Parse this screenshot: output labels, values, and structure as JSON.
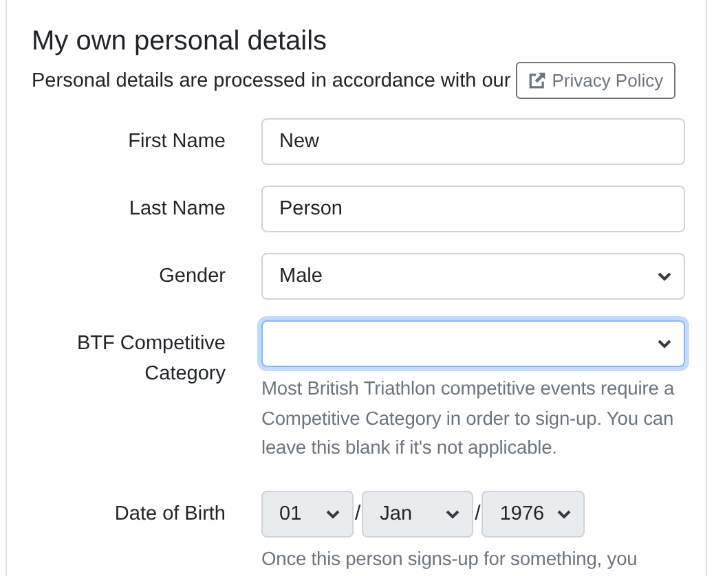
{
  "heading": "My own personal details",
  "notice": {
    "text": "Personal details are processed in accordance with our",
    "link": "Privacy Policy"
  },
  "fields": [
    {
      "kind": "text",
      "label": "First Name",
      "value": "New",
      "focused": false
    },
    {
      "kind": "text",
      "label": "Last Name",
      "value": "Person",
      "focused": false
    },
    {
      "kind": "select",
      "label": "Gender",
      "value": "Male",
      "focused": false
    },
    {
      "kind": "select",
      "label": "BTF Competitive Category",
      "focused": true,
      "help": "Most British Triathlon competitive events require a Competitive Category in order to sign-up. You can leave this blank if it's not applicable."
    },
    {
      "kind": "date",
      "label": "Date of Birth",
      "parts": [
        {
          "value": "01",
          "disabled": true
        },
        {
          "value": "Jan",
          "disabled": true
        },
        {
          "value": "1976",
          "disabled": true
        }
      ],
      "separator": "/",
      "help": "Once this person signs-up for something, you"
    }
  ]
}
